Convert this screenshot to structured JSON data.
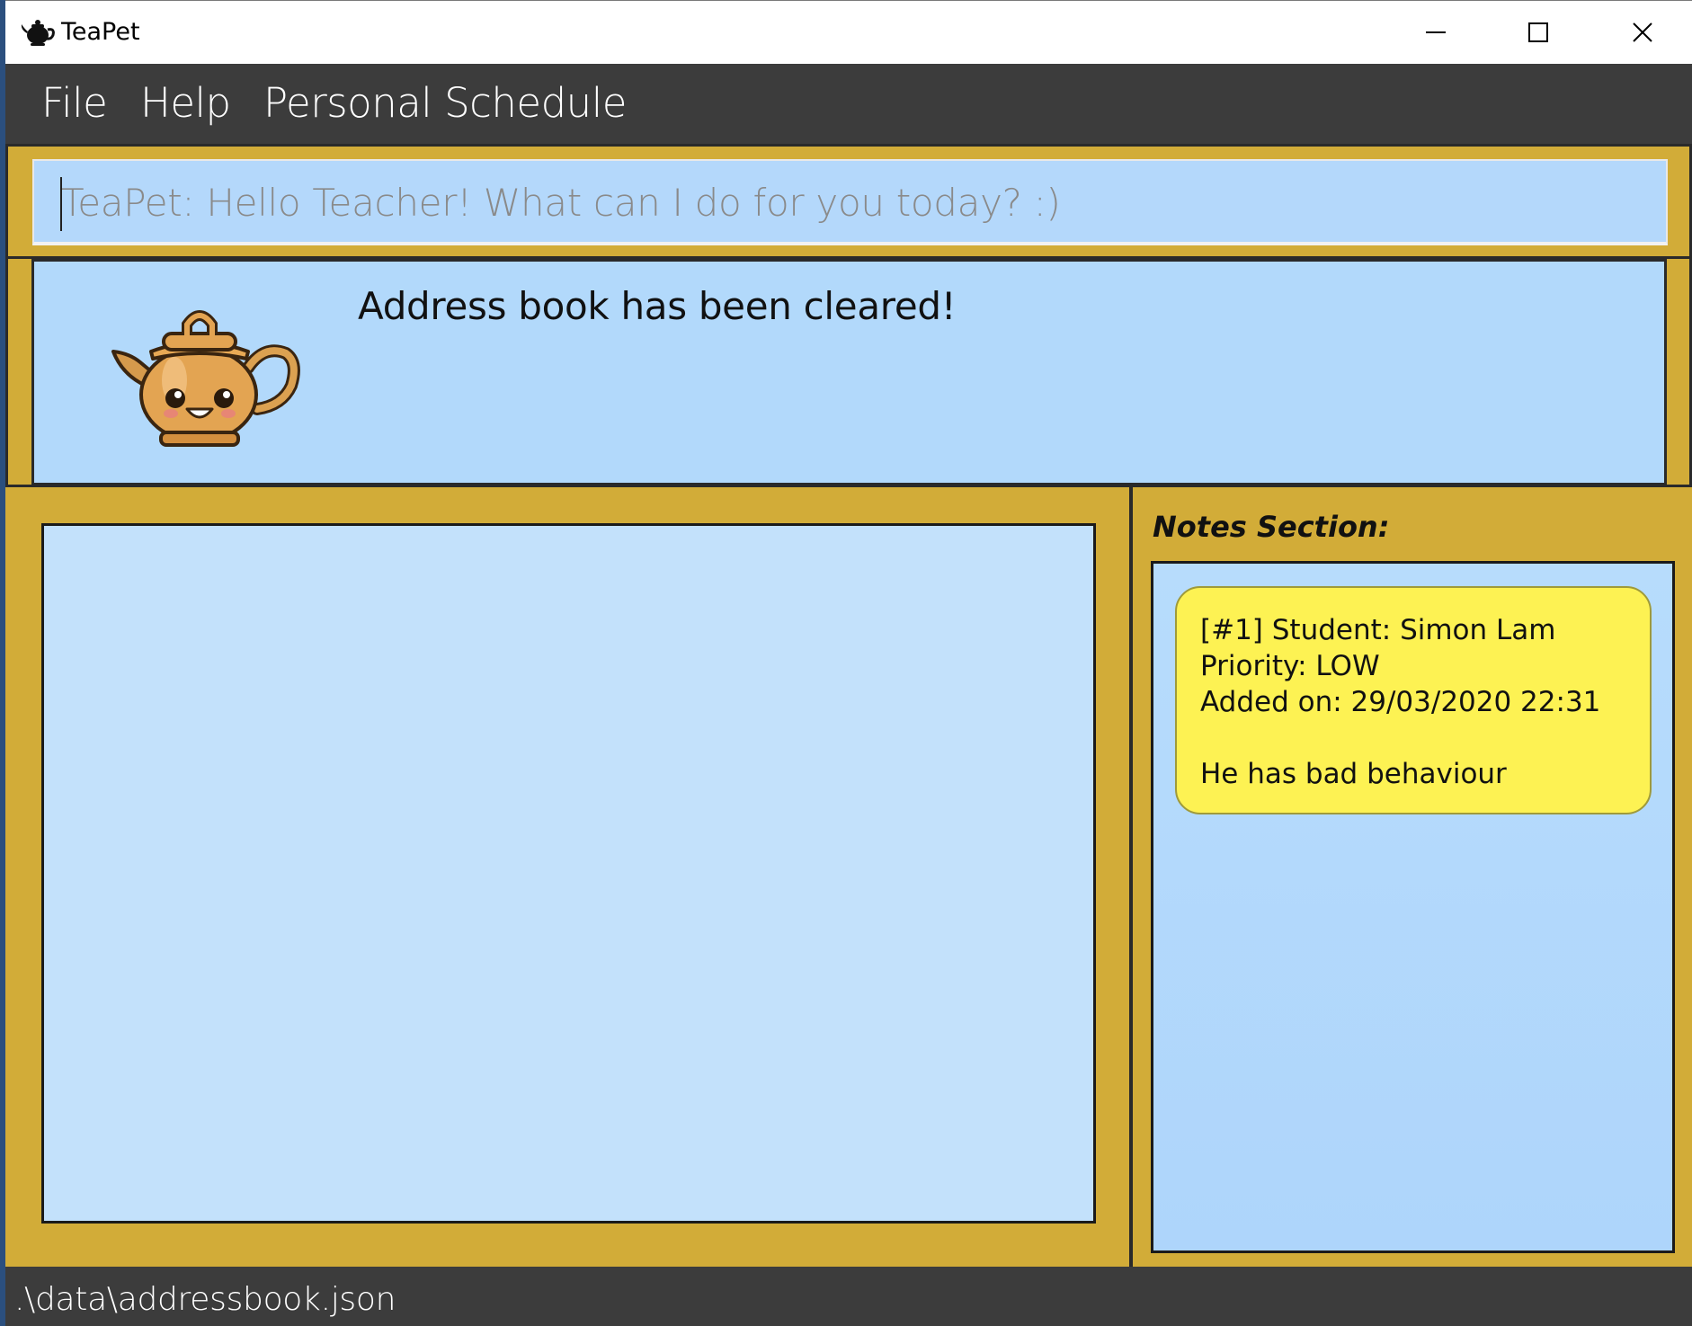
{
  "window": {
    "title": "TeaPet",
    "controls": {
      "minimize_icon": "minimize-icon",
      "maximize_icon": "maximize-icon",
      "close_icon": "close-icon"
    }
  },
  "menu": {
    "items": [
      {
        "label": "File"
      },
      {
        "label": "Help"
      },
      {
        "label": "Personal Schedule"
      }
    ]
  },
  "command": {
    "placeholder": "TeaPet: Hello Teacher! What can I do for you today? :)",
    "value": ""
  },
  "result": {
    "message": "Address book has been cleared!",
    "mascot_icon": "teapot-mascot-icon"
  },
  "notes": {
    "title": "Notes Section:",
    "items": [
      {
        "header": "[#1] Student: Simon Lam",
        "priority": "Priority: LOW",
        "added": "Added on: 29/03/2020 22:31",
        "body": "He has bad behaviour"
      }
    ]
  },
  "status": {
    "path": ".\\data\\addressbook.json"
  },
  "colors": {
    "accent_gold": "#d2ac38",
    "panel_blue": "#b2d9fb",
    "note_yellow": "#fdf253",
    "menubar_dark": "#3c3c3c"
  }
}
